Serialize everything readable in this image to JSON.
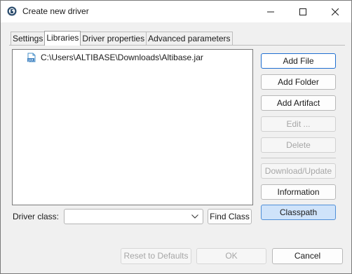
{
  "window": {
    "title": "Create new driver",
    "minimize_label": "Minimize",
    "maximize_label": "Maximize",
    "close_label": "Close"
  },
  "tabs": [
    {
      "label": "Settings",
      "active": false
    },
    {
      "label": "Libraries",
      "active": true
    },
    {
      "label": "Driver properties",
      "active": false
    },
    {
      "label": "Advanced parameters",
      "active": false
    }
  ],
  "libraries": {
    "items": [
      {
        "path": "C:\\Users\\ALTIBASE\\Downloads\\Altibase.jar",
        "icon": "jar-file-icon"
      }
    ]
  },
  "side_buttons": {
    "add_file": "Add File",
    "add_folder": "Add Folder",
    "add_artifact": "Add Artifact",
    "edit": "Edit ...",
    "delete": "Delete",
    "download_update": "Download/Update",
    "information": "Information",
    "classpath": "Classpath"
  },
  "driver_class": {
    "label": "Driver class:",
    "value": "",
    "find_class": "Find Class"
  },
  "footer": {
    "reset": "Reset to Defaults",
    "ok": "OK",
    "cancel": "Cancel"
  },
  "colors": {
    "accent": "#1f6fd1",
    "pressed_fill": "#cfe3fa",
    "disabled_text": "#a6a6a6"
  }
}
